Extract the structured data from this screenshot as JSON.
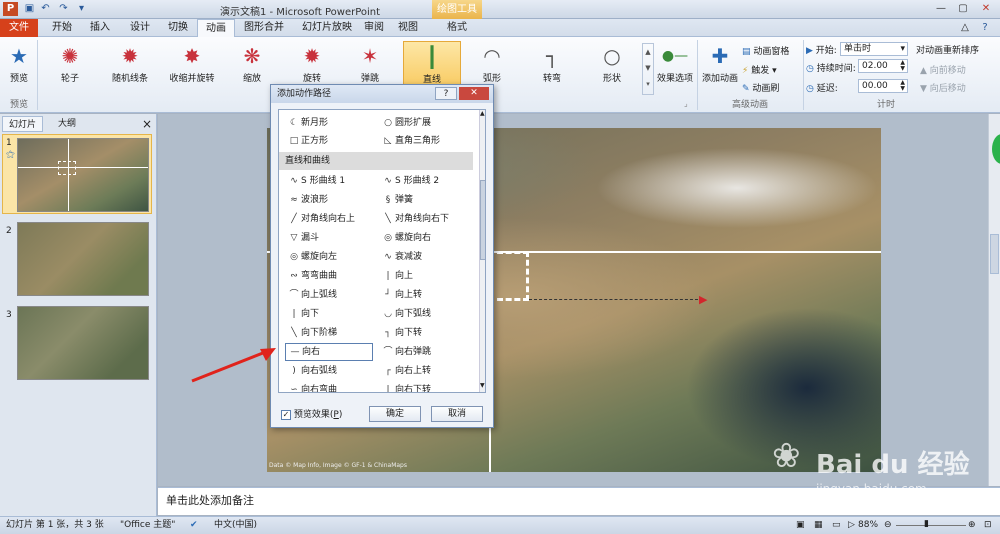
{
  "window": {
    "title": "演示文稿1 - Microsoft PowerPoint",
    "context_tool": "绘图工具",
    "qa_icons": [
      "ppt-icon",
      "save-icon",
      "undo-icon",
      "redo-icon",
      "customize-qa-icon"
    ]
  },
  "tabs": [
    "文件",
    "开始",
    "插入",
    "设计",
    "切换",
    "动画",
    "图形合并",
    "幻灯片放映",
    "审阅",
    "视图",
    "格式"
  ],
  "ribbon": {
    "preview": {
      "label": "预览",
      "group": "预览"
    },
    "effects": [
      {
        "label": "轮子",
        "icon": "✺"
      },
      {
        "label": "随机线条",
        "icon": "✹"
      },
      {
        "label": "收缩并旋转",
        "icon": "✸"
      },
      {
        "label": "缩放",
        "icon": "❋"
      },
      {
        "label": "旋转",
        "icon": "✹"
      },
      {
        "label": "弹跳",
        "icon": "✶"
      },
      {
        "label": "直线",
        "icon": "┃"
      },
      {
        "label": "弧形",
        "icon": "◠"
      },
      {
        "label": "转弯",
        "icon": "┐"
      },
      {
        "label": "形状",
        "icon": "○"
      }
    ],
    "effect_options": "效果选项",
    "group_advanced": "高级动画",
    "add_animation": "添加动画",
    "animation_pane": "动画窗格",
    "trigger": "触发",
    "animation_painter": "动画刷",
    "start_label": "开始:",
    "start_value": "单击时",
    "duration_label": "持续时间:",
    "duration_value": "02.00",
    "delay_label": "延迟:",
    "delay_value": "00.00",
    "group_timing": "计时",
    "reorder_title": "对动画重新排序",
    "move_earlier": "向前移动",
    "move_later": "向后移动"
  },
  "left_panel": {
    "tab_slides": "幻灯片",
    "tab_outline": "大纲",
    "close": "×",
    "slides": [
      "1",
      "2",
      "3"
    ]
  },
  "slide": {
    "attribution": "Data © Map Info, Image © GF-1 & ChinaMaps",
    "selected": "直线"
  },
  "notes_placeholder": "单击此处添加备注",
  "dialog": {
    "title": "添加动作路径",
    "help": "?",
    "close": "✕",
    "top_items": [
      [
        "新月形",
        "圆形扩展"
      ],
      [
        "正方形",
        "直角三角形"
      ]
    ],
    "category": "直线和曲线",
    "items": [
      [
        "S 形曲线 1",
        "S 形曲线 2"
      ],
      [
        "波浪形",
        "弹簧"
      ],
      [
        "对角线向右上",
        "对角线向右下"
      ],
      [
        "漏斗",
        "螺旋向右"
      ],
      [
        "螺旋向左",
        "衰减波"
      ],
      [
        "弯弯曲曲",
        "向上"
      ],
      [
        "向上弧线",
        "向上转"
      ],
      [
        "向下",
        "向下弧线"
      ],
      [
        "向下阶梯",
        "向下转"
      ],
      [
        "向右",
        "向右弹跳"
      ],
      [
        "向右弧线",
        "向右上转"
      ],
      [
        "向右弯曲",
        "向右下转"
      ]
    ],
    "selected_item": "向右",
    "preview_label": "预览效果",
    "preview_hotkey": "P",
    "ok": "确定",
    "cancel": "取消"
  },
  "status": {
    "slide_info": "幻灯片 第 1 张，共 3 张",
    "theme": "\"Office 主题\"",
    "language": "中文(中国)",
    "zoom": "88%"
  },
  "watermark": {
    "brand": "Bai du 经验",
    "url": "jingyan.baidu.com"
  }
}
